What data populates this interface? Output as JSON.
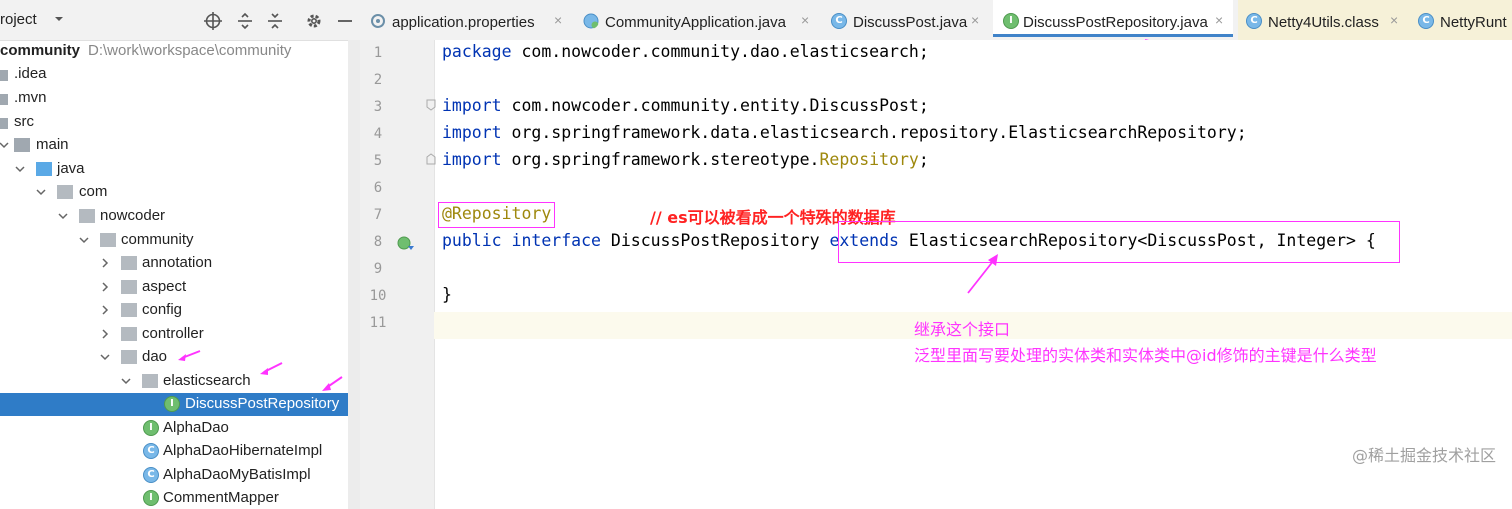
{
  "project_panel": {
    "title": "roject",
    "tree": [
      {
        "label": "community",
        "path": "D:\\work\\workspace\\community"
      },
      {
        "label": ".idea"
      },
      {
        "label": ".mvn"
      },
      {
        "label": "src"
      },
      {
        "label": "main"
      },
      {
        "label": "java"
      },
      {
        "label": "com"
      },
      {
        "label": "nowcoder"
      },
      {
        "label": "community"
      },
      {
        "label": "annotation"
      },
      {
        "label": "aspect"
      },
      {
        "label": "config"
      },
      {
        "label": "controller"
      },
      {
        "label": "dao"
      },
      {
        "label": "elasticsearch"
      },
      {
        "label": "DiscussPostRepository",
        "badge": "I"
      },
      {
        "label": "AlphaDao",
        "badge": "I"
      },
      {
        "label": "AlphaDaoHibernateImpl",
        "badge": "C"
      },
      {
        "label": "AlphaDaoMyBatisImpl",
        "badge": "C"
      },
      {
        "label": "CommentMapper",
        "badge": "I"
      }
    ]
  },
  "tabs": [
    {
      "label": "application.properties",
      "close": "×"
    },
    {
      "label": "CommunityApplication.java",
      "close": "×"
    },
    {
      "label": "DiscussPost.java",
      "close": "×"
    },
    {
      "label": "DiscussPostRepository.java",
      "close": "×",
      "badge": "I"
    },
    {
      "label": "Netty4Utils.class",
      "close": "×",
      "badge": "C"
    },
    {
      "label": "NettyRunt",
      "badge": "C"
    }
  ],
  "editor": {
    "line_numbers": [
      "1",
      "2",
      "3",
      "4",
      "5",
      "6",
      "7",
      "8",
      "9",
      "10",
      "11"
    ],
    "line1": {
      "kw": "package",
      "rest": " com.nowcoder.community.dao.elasticsearch;"
    },
    "line3": {
      "kw": "import",
      "rest": " com.nowcoder.community.entity.DiscussPost;"
    },
    "line4": {
      "kw": "import",
      "rest": " org.springframework.data.elasticsearch.repository.ElasticsearchRepository;"
    },
    "line5": {
      "kw": "import",
      "rest": " org.springframework.stereotype.",
      "anno": "Repository",
      "end": ";"
    },
    "line7": {
      "anno": "@Repository",
      "comment": "// es可以被看成一个特殊的数据库"
    },
    "line8": {
      "kw1": "public",
      "kw2": "interface",
      "name": " DiscussPostRepository ",
      "kw3": "extends",
      "rest": " ElasticsearchRepository<DiscussPost, Integer>",
      "brace": " {"
    },
    "line10": {
      "text": "}"
    }
  },
  "annotations": {
    "note_line1": "继承这个接口",
    "note_line2": "泛型里面写要处理的实体类和实体类中@id修饰的主键是什么类型"
  },
  "watermark": "@稀土掘金技术社区",
  "colors": {
    "keyword": "#0033b3",
    "annotation": "#9e880d",
    "highlight": "#ff33ff",
    "selection": "#2f7cc7",
    "comment": "#ff2222"
  }
}
